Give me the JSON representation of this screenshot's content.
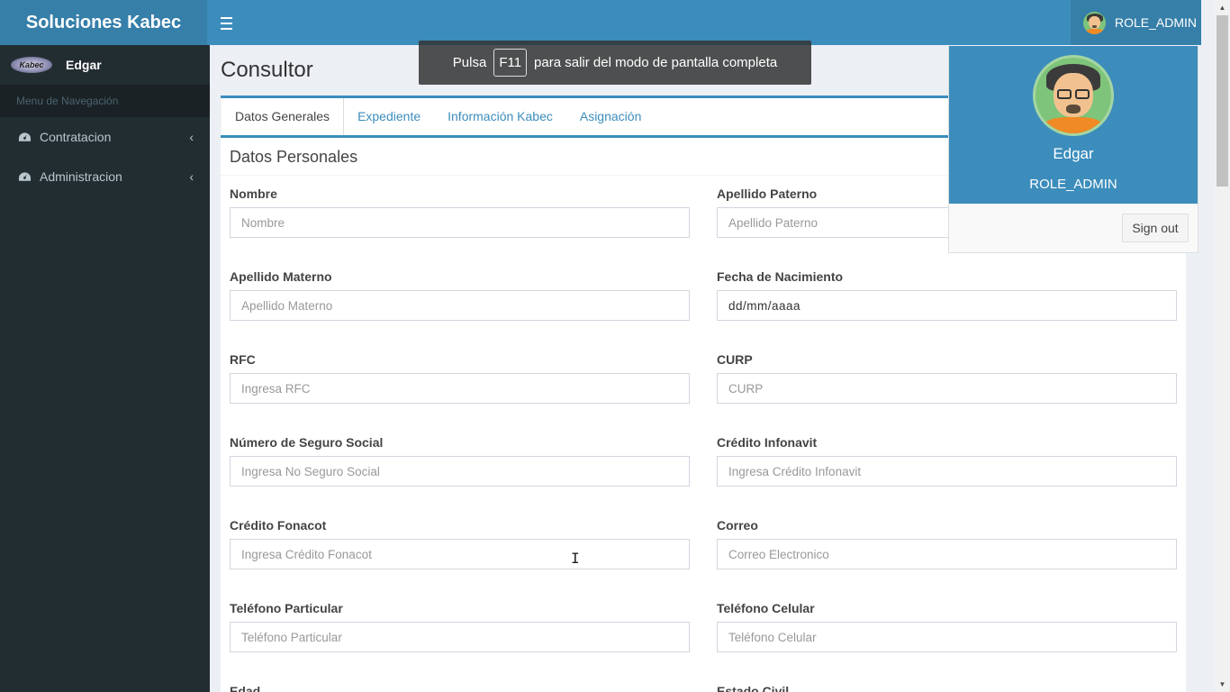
{
  "app": {
    "title": "Soluciones Kabec"
  },
  "header": {
    "user_role": "ROLE_ADMIN"
  },
  "sidebar": {
    "logo_text": "Kabec",
    "user_name": "Edgar",
    "nav_header": "Menu de Navegación",
    "items": [
      {
        "label": "Contratacion",
        "icon": "dashboard-icon"
      },
      {
        "label": "Administracion",
        "icon": "dashboard-icon"
      }
    ]
  },
  "page": {
    "title": "Consultor"
  },
  "tabs": [
    {
      "label": "Datos Generales",
      "active": true
    },
    {
      "label": "Expediente"
    },
    {
      "label": "Información Kabec"
    },
    {
      "label": "Asignación"
    }
  ],
  "section": {
    "title": "Datos Personales"
  },
  "form": {
    "fields": [
      {
        "label": "Nombre",
        "placeholder": "Nombre"
      },
      {
        "label": "Apellido Paterno",
        "placeholder": "Apellido Paterno"
      },
      {
        "label": "Apellido Materno",
        "placeholder": "Apellido Materno"
      },
      {
        "label": "Fecha de Nacimiento",
        "placeholder": "dd/mm/aaaa"
      },
      {
        "label": "RFC",
        "placeholder": "Ingresa RFC"
      },
      {
        "label": "CURP",
        "placeholder": "CURP"
      },
      {
        "label": "Número de Seguro Social",
        "placeholder": "Ingresa No Seguro Social"
      },
      {
        "label": "Crédito Infonavit",
        "placeholder": "Ingresa Crédito Infonavit"
      },
      {
        "label": "Crédito Fonacot",
        "placeholder": "Ingresa Crédito Fonacot"
      },
      {
        "label": "Correo",
        "placeholder": "Correo Electronico"
      },
      {
        "label": "Teléfono Particular",
        "placeholder": "Teléfono Particular"
      },
      {
        "label": "Teléfono Celular",
        "placeholder": "Teléfono Celular"
      },
      {
        "label": "Edad",
        "placeholder": ""
      },
      {
        "label": "Estado Civil",
        "placeholder": ""
      }
    ]
  },
  "fullscreen_notice": {
    "before": "Pulsa",
    "key": "F11",
    "after": "para salir del modo de pantalla completa"
  },
  "user_dropdown": {
    "name": "Edgar",
    "role": "ROLE_ADMIN",
    "signout_label": "Sign out"
  }
}
